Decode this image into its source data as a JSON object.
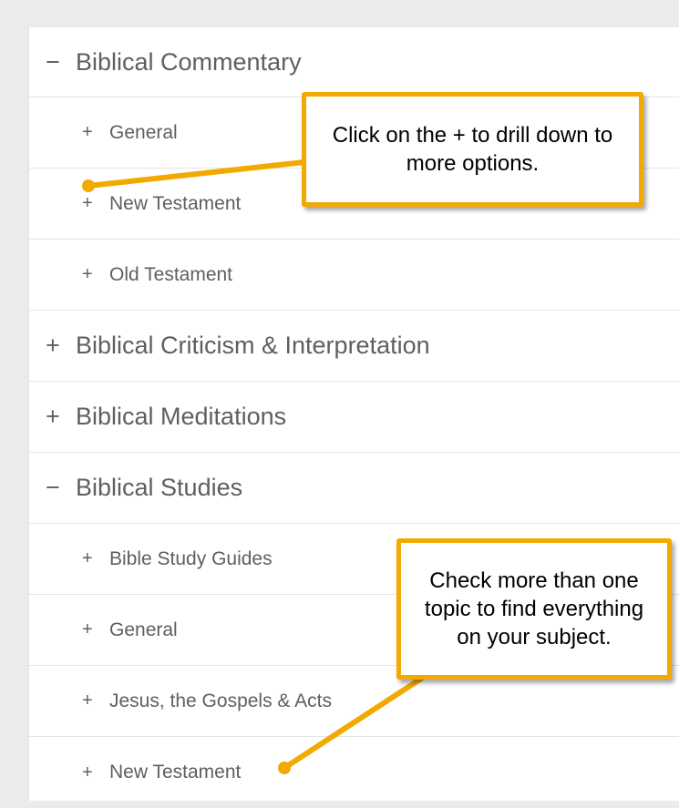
{
  "categories": [
    {
      "toggle": "−",
      "label": "Biblical Commentary"
    },
    {
      "toggle": "+",
      "label": "General"
    },
    {
      "toggle": "+",
      "label": "New Testament"
    },
    {
      "toggle": "+",
      "label": "Old Testament"
    },
    {
      "toggle": "+",
      "label": "Biblical Criticism & Interpretation"
    },
    {
      "toggle": "+",
      "label": "Biblical Meditations"
    },
    {
      "toggle": "−",
      "label": "Biblical Studies"
    },
    {
      "toggle": "+",
      "label": "Bible Study Guides"
    },
    {
      "toggle": "+",
      "label": "General"
    },
    {
      "toggle": "+",
      "label": "Jesus, the Gospels & Acts"
    },
    {
      "toggle": "+",
      "label": "New Testament"
    }
  ],
  "callouts": {
    "drill_down": "Click on the + to drill down to more options.",
    "check_topics": "Check more than one topic to find everything on your subject."
  },
  "colors": {
    "callout_border": "#f2a900",
    "text": "#5f5f5f",
    "background": "#ebebeb"
  }
}
